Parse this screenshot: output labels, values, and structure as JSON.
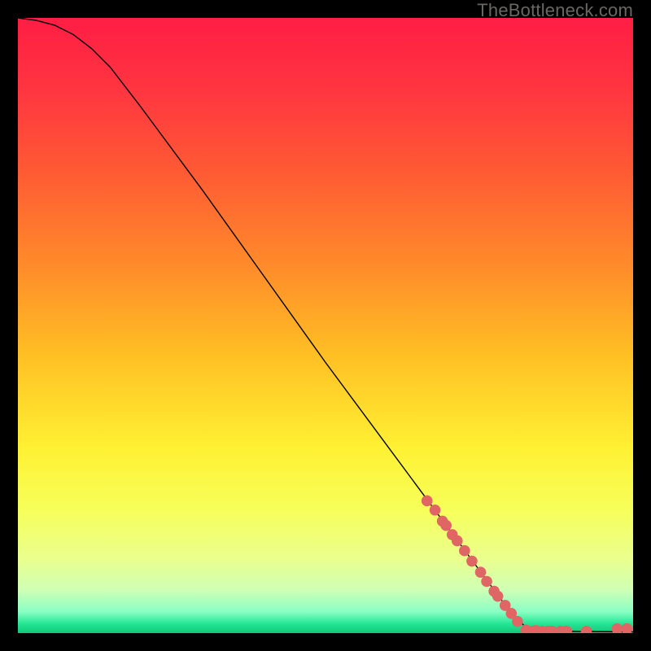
{
  "watermark": "TheBottleneck.com",
  "chart_data": {
    "type": "line",
    "title": "",
    "xlabel": "",
    "ylabel": "",
    "xlim": [
      0,
      100
    ],
    "ylim": [
      0,
      100
    ],
    "curve": [
      {
        "x": 0,
        "y": 100
      },
      {
        "x": 3,
        "y": 99.6
      },
      {
        "x": 6,
        "y": 98.8
      },
      {
        "x": 9,
        "y": 97.3
      },
      {
        "x": 12,
        "y": 95
      },
      {
        "x": 15,
        "y": 92
      },
      {
        "x": 20,
        "y": 85.5
      },
      {
        "x": 30,
        "y": 72
      },
      {
        "x": 40,
        "y": 58
      },
      {
        "x": 50,
        "y": 44
      },
      {
        "x": 60,
        "y": 30.5
      },
      {
        "x": 70,
        "y": 17
      },
      {
        "x": 80,
        "y": 3.5
      },
      {
        "x": 83,
        "y": 0.5
      },
      {
        "x": 86,
        "y": 0.3
      },
      {
        "x": 100,
        "y": 0.2
      }
    ],
    "points": [
      {
        "x": 66.5,
        "y": 21.5
      },
      {
        "x": 67.8,
        "y": 20.0
      },
      {
        "x": 69.0,
        "y": 18.2
      },
      {
        "x": 69.6,
        "y": 17.5
      },
      {
        "x": 70.6,
        "y": 16.0
      },
      {
        "x": 71.4,
        "y": 15.0
      },
      {
        "x": 72.6,
        "y": 13.4
      },
      {
        "x": 73.8,
        "y": 11.7
      },
      {
        "x": 75.2,
        "y": 9.9
      },
      {
        "x": 76.2,
        "y": 8.4
      },
      {
        "x": 77.4,
        "y": 6.8
      },
      {
        "x": 78.0,
        "y": 6.0
      },
      {
        "x": 79.2,
        "y": 4.5
      },
      {
        "x": 80.2,
        "y": 3.2
      },
      {
        "x": 81.2,
        "y": 1.9
      },
      {
        "x": 82.6,
        "y": 0.5
      },
      {
        "x": 83.6,
        "y": 0.3
      },
      {
        "x": 84.2,
        "y": 0.4
      },
      {
        "x": 85.2,
        "y": 0.3
      },
      {
        "x": 86.2,
        "y": 0.3
      },
      {
        "x": 86.8,
        "y": 0.3
      },
      {
        "x": 88.2,
        "y": 0.3
      },
      {
        "x": 89.2,
        "y": 0.3
      },
      {
        "x": 92.4,
        "y": 0.3
      },
      {
        "x": 97.4,
        "y": 0.7
      },
      {
        "x": 99.0,
        "y": 0.7
      }
    ],
    "gradient_stops": [
      {
        "offset": 0.0,
        "color": "#ff1d44"
      },
      {
        "offset": 0.12,
        "color": "#ff3640"
      },
      {
        "offset": 0.25,
        "color": "#ff5a34"
      },
      {
        "offset": 0.4,
        "color": "#ff8a2a"
      },
      {
        "offset": 0.55,
        "color": "#ffc024"
      },
      {
        "offset": 0.7,
        "color": "#fff133"
      },
      {
        "offset": 0.8,
        "color": "#f6ff5a"
      },
      {
        "offset": 0.88,
        "color": "#eaff8e"
      },
      {
        "offset": 0.93,
        "color": "#cfffb5"
      },
      {
        "offset": 0.965,
        "color": "#8affc4"
      },
      {
        "offset": 0.985,
        "color": "#22e694"
      },
      {
        "offset": 1.0,
        "color": "#10c878"
      }
    ],
    "point_color": "#e06666",
    "line_color": "#000000"
  }
}
